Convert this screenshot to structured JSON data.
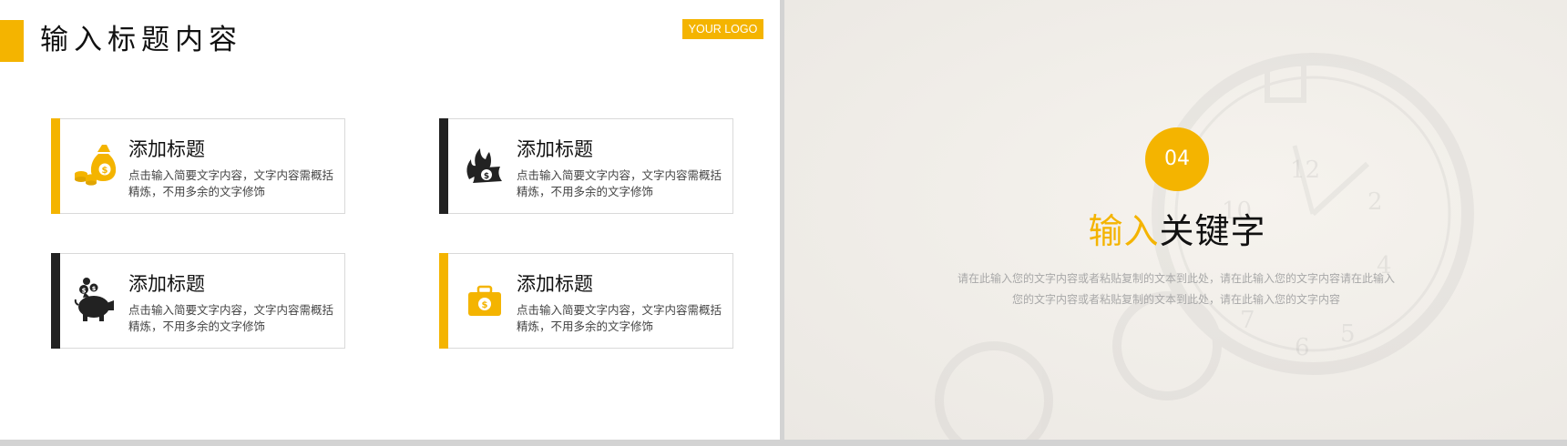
{
  "left_slide": {
    "title": "输入标题内容",
    "logo": "YOUR LOGO",
    "cards": [
      {
        "title": "添加标题",
        "desc": "点击输入简要文字内容，文字内容需概括精炼，不用多余的文字修饰",
        "icon": "money-bag-icon",
        "accent": "#f4b400"
      },
      {
        "title": "添加标题",
        "desc": "点击输入简要文字内容，文字内容需概括精炼，不用多余的文字修饰",
        "icon": "burning-money-icon",
        "accent": "#222222"
      },
      {
        "title": "添加标题",
        "desc": "点击输入简要文字内容，文字内容需概括精炼，不用多余的文字修饰",
        "icon": "piggy-bank-icon",
        "accent": "#222222"
      },
      {
        "title": "添加标题",
        "desc": "点击输入简要文字内容，文字内容需概括精炼，不用多余的文字修饰",
        "icon": "briefcase-dollar-icon",
        "accent": "#f4b400"
      }
    ]
  },
  "right_slide": {
    "number": "04",
    "keyword_part1": "输入",
    "keyword_part2": "关键字",
    "desc": "请在此输入您的文字内容或者粘贴复制的文本到此处，请在此输入您的文字内容请在此输入您的文字内容或者粘贴复制的文本到此处，请在此输入您的文字内容"
  },
  "colors": {
    "accent": "#f4b400",
    "dark": "#222222",
    "text": "#111111",
    "muted": "#a8a8a8"
  }
}
